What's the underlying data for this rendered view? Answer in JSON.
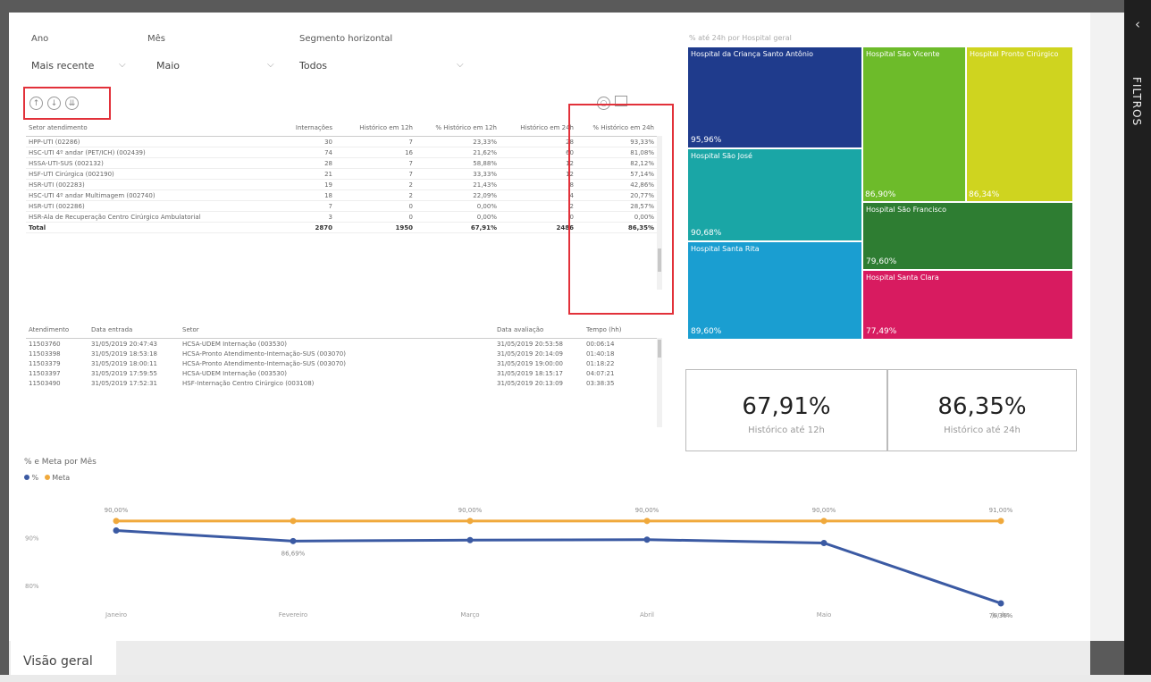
{
  "slicers": {
    "ano": {
      "label": "Ano",
      "value": "Mais recente"
    },
    "mes": {
      "label": "Mês",
      "value": "Maio"
    },
    "segmento": {
      "label": "Segmento horizontal",
      "value": "Todos"
    }
  },
  "table1": {
    "headers": [
      "Setor atendimento",
      "Internações",
      "Histórico em 12h",
      "% Histórico em 12h",
      "Histórico em 24h",
      "% Histórico em 24h"
    ],
    "rows": [
      [
        "HPP-UTI (02286)",
        "30",
        "7",
        "23,33%",
        "28",
        "93,33%"
      ],
      [
        "HSC-UTI 4º andar (PET/ICH) (002439)",
        "74",
        "16",
        "21,62%",
        "60",
        "81,08%"
      ],
      [
        "HSSA-UTI-SUS (002132)",
        "28",
        "7",
        "58,88%",
        "12",
        "82,12%"
      ],
      [
        "HSF-UTI Cirúrgica (002190)",
        "21",
        "7",
        "33,33%",
        "12",
        "57,14%"
      ],
      [
        "HSR-UTI (002283)",
        "19",
        "2",
        "21,43%",
        "8",
        "42,86%"
      ],
      [
        "HSC-UTI 4º andar Multimagem (002740)",
        "18",
        "2",
        "22,09%",
        "4",
        "20,77%"
      ],
      [
        "HSR-UTI (002286)",
        "7",
        "0",
        "0,00%",
        "2",
        "28,57%"
      ],
      [
        "HSR-Ala de Recuperação Centro Cirúrgico Ambulatorial",
        "3",
        "0",
        "0,00%",
        "0",
        "0,00%"
      ]
    ],
    "total": [
      "Total",
      "2870",
      "1950",
      "67,91%",
      "2486",
      "86,35%"
    ]
  },
  "table2": {
    "headers": [
      "Atendimento",
      "Data entrada",
      "Setor",
      "Data avaliação",
      "Tempo (hh)"
    ],
    "rows": [
      [
        "11503760",
        "31/05/2019 20:47:43",
        "HCSA-UDEM Internação (003530)",
        "31/05/2019 20:53:58",
        "00:06:14"
      ],
      [
        "11503398",
        "31/05/2019 18:53:18",
        "HCSA-Pronto Atendimento-Internação-SUS (003070)",
        "31/05/2019 20:14:09",
        "01:40:18"
      ],
      [
        "11503379",
        "31/05/2019 18:00:11",
        "HCSA-Pronto Atendimento-Internação-SUS (003070)",
        "31/05/2019 19:00:00",
        "01:18:22"
      ],
      [
        "11503397",
        "31/05/2019 17:59:55",
        "HCSA-UDEM Internação (003530)",
        "31/05/2019 18:15:17",
        "04:07:21"
      ],
      [
        "11503490",
        "31/05/2019 17:52:31",
        "HSF-Internação Centro Cirúrgico (003108)",
        "31/05/2019 20:13:09",
        "03:38:35"
      ]
    ]
  },
  "treemap": {
    "title": "% até 24h por Hospital geral",
    "tiles": [
      {
        "name": "Hospital da Criança Santo Antônio",
        "value": "95,96%",
        "color": "#1f3b8c"
      },
      {
        "name": "Hospital São Vicente",
        "value": "",
        "color": "#6dbb2a"
      },
      {
        "name": "Hospital Pronto Cirúrgico",
        "value": "",
        "color": "#cfd41f"
      },
      {
        "name": "Hospital São José",
        "value": "90,68%",
        "color": "#1aa6a6"
      },
      {
        "name": "",
        "value": "86,90%",
        "color": "#6dbb2a"
      },
      {
        "name": "",
        "value": "86,34%",
        "color": "#cfd41f"
      },
      {
        "name": "Hospital São Francisco",
        "value": "79,60%",
        "color": "#2e7d32"
      },
      {
        "name": "Hospital Santa Rita",
        "value": "89,60%",
        "color": "#1a9ed1"
      },
      {
        "name": "Hospital Santa Clara",
        "value": "77,49%",
        "color": "#d81b60"
      }
    ]
  },
  "cards": [
    {
      "value": "67,91%",
      "label": "Histórico até 12h"
    },
    {
      "value": "86,35%",
      "label": "Histórico até 24h"
    }
  ],
  "line_chart": {
    "title": "% e Meta por Mês",
    "legend": [
      "%",
      "Meta"
    ],
    "y_ticks": [
      "90%",
      "80%"
    ]
  },
  "chart_data": {
    "type": "line",
    "title": "% e Meta por Mês",
    "categories": [
      "Janeiro",
      "Fevereiro",
      "Março",
      "Abril",
      "Maio",
      "Junho"
    ],
    "series": [
      {
        "name": "%",
        "values": [
          91.5,
          89.3,
          89.5,
          89.6,
          88.9,
          76.3
        ],
        "labels": [
          "",
          "86,69%",
          "",
          "",
          "",
          "76,36%"
        ],
        "color": "#3b5aa3"
      },
      {
        "name": "Meta",
        "values": [
          93.5,
          93.5,
          93.5,
          93.5,
          93.5,
          93.5
        ],
        "labels": [
          "90,00%",
          "",
          "90,00%",
          "90,00%",
          "90,00%",
          "91,00%"
        ],
        "color": "#f0a93c"
      }
    ],
    "ylim": [
      72,
      100
    ],
    "ytick_values": [
      90,
      80
    ],
    "ylabel": "",
    "xlabel": "",
    "legend_position": "top-left",
    "grid": false
  },
  "tabs": [
    {
      "label": "Visão geral"
    }
  ],
  "side_pane": {
    "label": "FILTROS",
    "chevron": "‹"
  }
}
